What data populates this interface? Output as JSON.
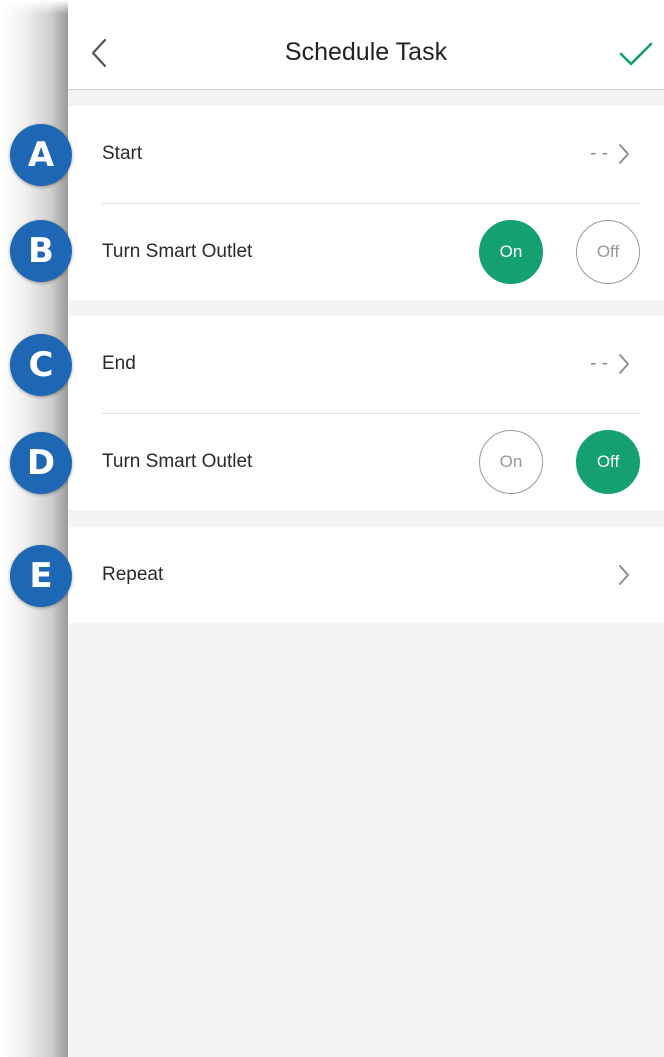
{
  "header": {
    "title": "Schedule Task",
    "back_icon": "chevron-left-icon",
    "confirm_icon": "checkmark-icon"
  },
  "start_group": {
    "start_label": "Start",
    "start_value": "- -",
    "outlet_label": "Turn Smart Outlet",
    "on_label": "On",
    "off_label": "Off",
    "selected": "On"
  },
  "end_group": {
    "end_label": "End",
    "end_value": "- -",
    "outlet_label": "Turn Smart Outlet",
    "on_label": "On",
    "off_label": "Off",
    "selected": "Off"
  },
  "repeat_group": {
    "repeat_label": "Repeat"
  },
  "callouts": [
    "A",
    "B",
    "C",
    "D",
    "E"
  ],
  "colors": {
    "accent_green": "#14a06f",
    "callout_blue": "#1e67b4",
    "background": "#f4f4f4"
  }
}
